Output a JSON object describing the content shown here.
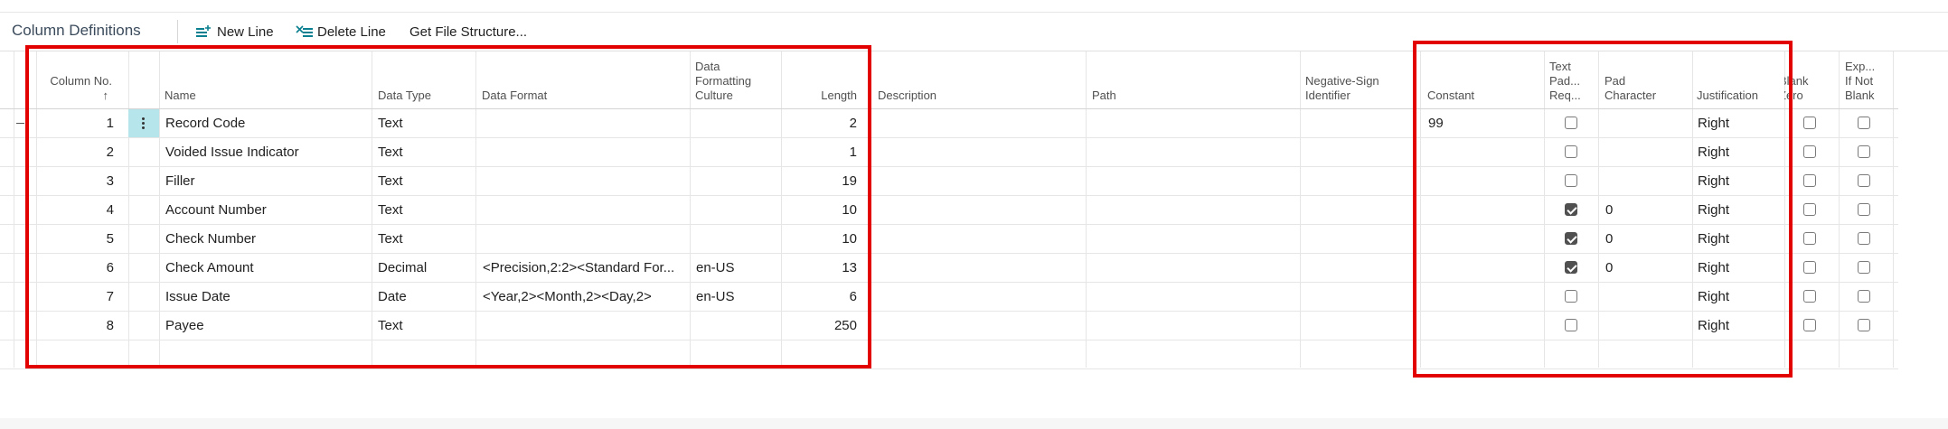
{
  "toolbar": {
    "title": "Column Definitions",
    "new_line": "New Line",
    "delete_line": "Delete Line",
    "get_file_structure": "Get File Structure..."
  },
  "columns": {
    "column_no": "Column No.",
    "sort_arrow": "↑",
    "name": "Name",
    "data_type": "Data Type",
    "data_format": "Data Format",
    "data_formatting_culture": "Data Formatting Culture",
    "length": "Length",
    "description": "Description",
    "path": "Path",
    "negative_sign_identifier": "Negative-Sign Identifier",
    "constant": "Constant",
    "text_padding_required": "Text Pad... Req...",
    "pad_character": "Pad Character",
    "justification": "Justification",
    "blank_zero": "Blank Zero",
    "export_if_not_blank": "Exp... If Not Blank"
  },
  "rows": [
    {
      "no": "1",
      "name": "Record Code",
      "type": "Text",
      "format": "",
      "culture": "",
      "length": "2",
      "constant": "99",
      "pad_req": false,
      "pad_char": "",
      "just": "Right",
      "blank_zero": false,
      "export": false
    },
    {
      "no": "2",
      "name": "Voided Issue Indicator",
      "type": "Text",
      "format": "",
      "culture": "",
      "length": "1",
      "constant": "",
      "pad_req": false,
      "pad_char": "",
      "just": "Right",
      "blank_zero": false,
      "export": false
    },
    {
      "no": "3",
      "name": "Filler",
      "type": "Text",
      "format": "",
      "culture": "",
      "length": "19",
      "constant": "",
      "pad_req": false,
      "pad_char": "",
      "just": "Right",
      "blank_zero": false,
      "export": false
    },
    {
      "no": "4",
      "name": "Account Number",
      "type": "Text",
      "format": "",
      "culture": "",
      "length": "10",
      "constant": "",
      "pad_req": true,
      "pad_char": "0",
      "just": "Right",
      "blank_zero": false,
      "export": false
    },
    {
      "no": "5",
      "name": "Check Number",
      "type": "Text",
      "format": "",
      "culture": "",
      "length": "10",
      "constant": "",
      "pad_req": true,
      "pad_char": "0",
      "just": "Right",
      "blank_zero": false,
      "export": false
    },
    {
      "no": "6",
      "name": "Check Amount",
      "type": "Decimal",
      "format": "<Precision,2:2><Standard For...",
      "culture": "en-US",
      "length": "13",
      "constant": "",
      "pad_req": true,
      "pad_char": "0",
      "just": "Right",
      "blank_zero": false,
      "export": false
    },
    {
      "no": "7",
      "name": "Issue Date",
      "type": "Date",
      "format": "<Year,2><Month,2><Day,2>",
      "culture": "en-US",
      "length": "6",
      "constant": "",
      "pad_req": false,
      "pad_char": "",
      "just": "Right",
      "blank_zero": false,
      "export": false
    },
    {
      "no": "8",
      "name": "Payee",
      "type": "Text",
      "format": "",
      "culture": "",
      "length": "250",
      "constant": "",
      "pad_req": false,
      "pad_char": "",
      "just": "Right",
      "blank_zero": false,
      "export": false
    }
  ],
  "colors": {
    "highlight_box": "#e30000",
    "row_menu": "#b7e5ec",
    "accent_icon": "#0a7f8f"
  }
}
